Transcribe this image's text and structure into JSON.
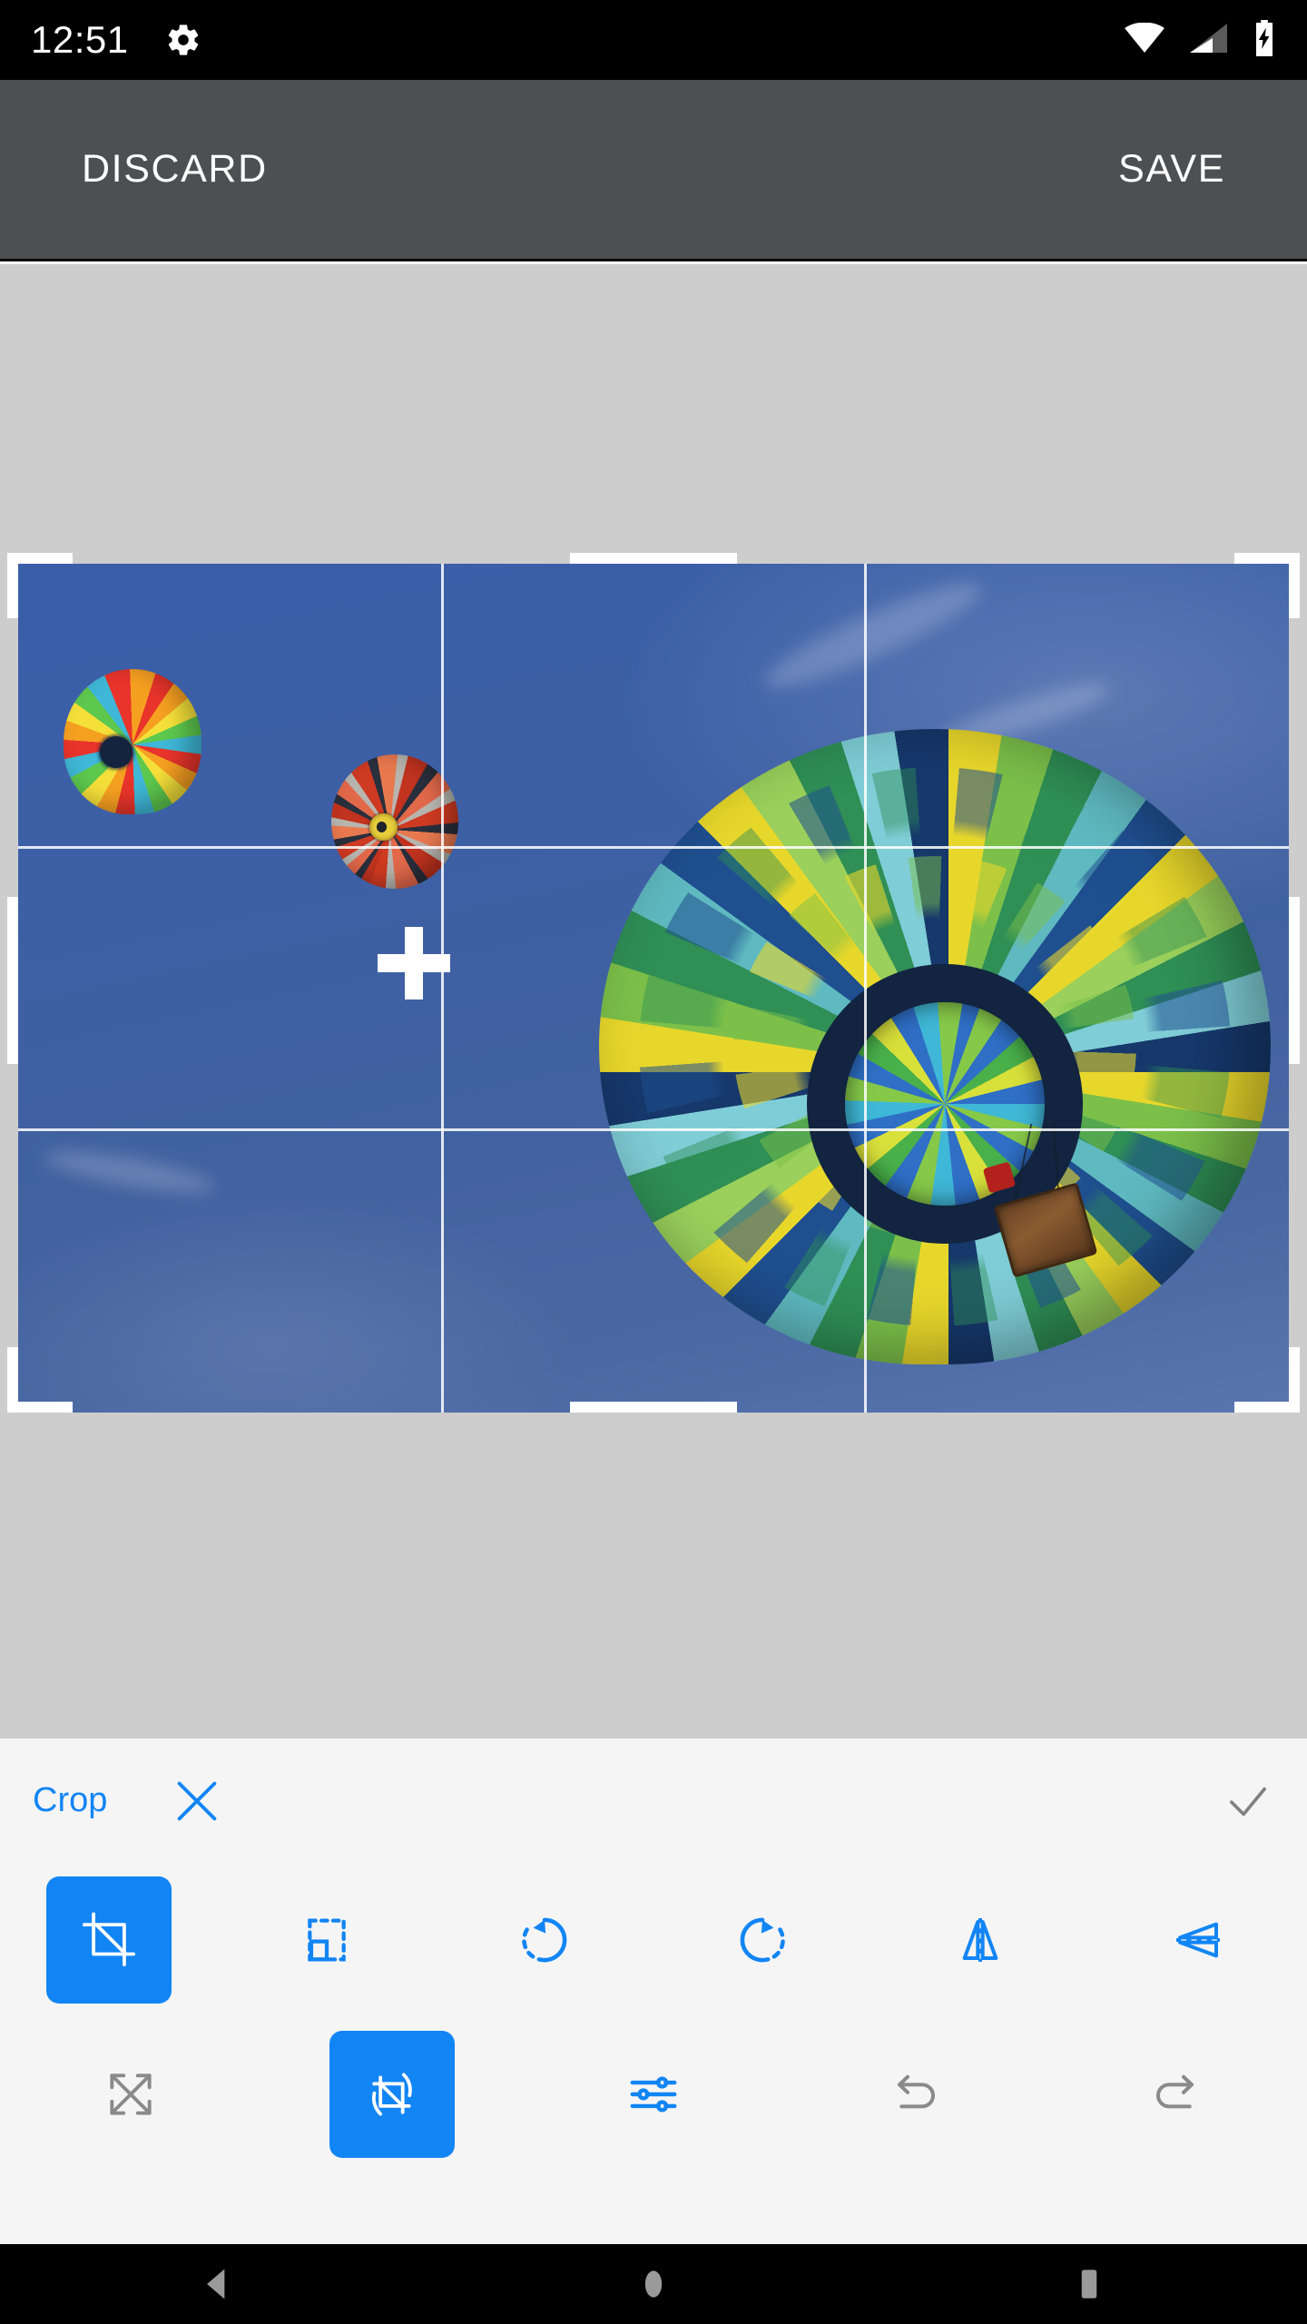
{
  "status_bar": {
    "clock": "12:51",
    "icons": {
      "settings": "gear-icon",
      "wifi": "wifi-full-icon",
      "cellular": "cellular-signal-icon",
      "battery": "battery-charging-icon"
    }
  },
  "app_bar": {
    "discard_label": "DISCARD",
    "save_label": "SAVE",
    "background": "#4c5053"
  },
  "editor": {
    "tool_title": "Crop",
    "accent_color": "#1285f5",
    "canvas_background": "#cdcdcd",
    "crop": {
      "grid": "rule-of-thirds",
      "handles": [
        "top-left",
        "top-center",
        "top-right",
        "middle-left",
        "middle-right",
        "bottom-left",
        "bottom-center",
        "bottom-right"
      ],
      "crosshair_marker": true
    },
    "photo": {
      "subject": "three hot air balloons in blue sky",
      "sky_color": "#41619f"
    },
    "header_actions": [
      {
        "name": "cancel-crop-button",
        "icon": "close-x-icon",
        "color": "#1285f5"
      },
      {
        "name": "confirm-crop-button",
        "icon": "checkmark-icon",
        "color": "#808080"
      }
    ],
    "tool_row_1": [
      {
        "name": "crop-tool-button",
        "icon": "crop-icon",
        "active": true
      },
      {
        "name": "aspect-ratio-button",
        "icon": "aspect-ratio-icon",
        "active": false
      },
      {
        "name": "rotate-left-button",
        "icon": "rotate-counterclockwise-icon",
        "active": false
      },
      {
        "name": "rotate-right-button",
        "icon": "rotate-clockwise-icon",
        "active": false
      },
      {
        "name": "flip-horizontal-button",
        "icon": "flip-horizontal-icon",
        "active": false
      },
      {
        "name": "flip-vertical-button",
        "icon": "flip-vertical-icon",
        "active": false
      }
    ],
    "tool_row_2": [
      {
        "name": "transform-button",
        "icon": "expand-arrows-icon",
        "active": false,
        "enabled": false
      },
      {
        "name": "crop-rotate-button",
        "icon": "crop-rotate-icon",
        "active": true
      },
      {
        "name": "adjust-button",
        "icon": "sliders-icon",
        "active": false
      },
      {
        "name": "undo-button",
        "icon": "undo-arrow-icon",
        "active": false,
        "enabled": false
      },
      {
        "name": "redo-button",
        "icon": "redo-arrow-icon",
        "active": false,
        "enabled": false
      }
    ]
  },
  "nav_bar": {
    "back": "back-triangle-icon",
    "home": "home-circle-icon",
    "recents": "recents-square-icon"
  }
}
